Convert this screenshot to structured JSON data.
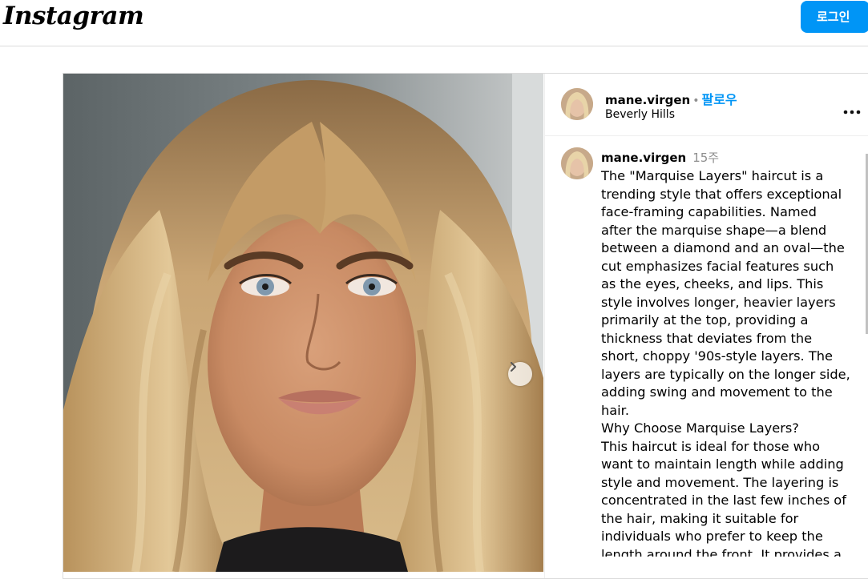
{
  "header": {
    "logo": "Instagram",
    "login_label": "로그인"
  },
  "post": {
    "author": {
      "username": "mane.virgen",
      "follow_label": "팔로우",
      "location": "Beverly Hills",
      "separator": "•"
    },
    "caption": {
      "username": "mane.virgen",
      "time": "15주",
      "paragraphs": [
        "The \"Marquise Layers\" haircut is a trending style that offers exceptional face-framing capabilities. Named after the marquise shape—a blend between a diamond and an oval—the cut emphasizes facial features such as the eyes, cheeks, and lips. This style involves longer, heavier layers primarily at the top, providing a thickness that deviates from the short, choppy '90s-style layers. The layers are typically on the longer side, adding swing and movement to the hair.",
        "Why Choose Marquise Layers?",
        "This haircut is ideal for those who want to maintain length while adding style and movement. The layering is concentrated in the last few inches of the hair, making it suitable for individuals who prefer to keep the length around the front. It provides a look of really long hair without the"
      ]
    }
  },
  "icons": {
    "next": "chevron-right-icon",
    "more": "more-horizontal-icon"
  },
  "colors": {
    "accent": "#0095f6",
    "secondary_text": "#8e8e8e",
    "border": "#dbdbdb"
  }
}
